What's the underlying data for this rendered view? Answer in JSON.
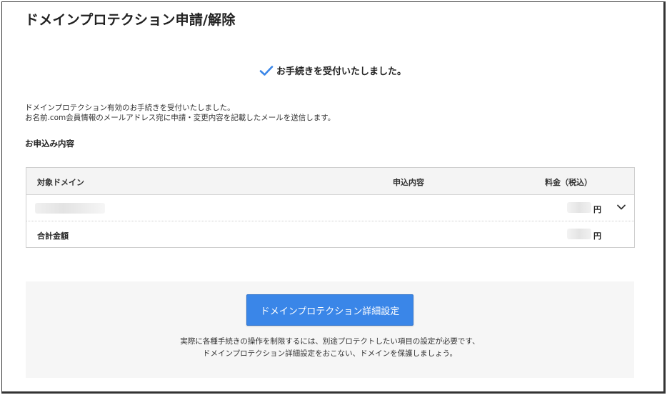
{
  "page": {
    "title": "ドメインプロテクション申請/解除"
  },
  "status": {
    "message": "お手続きを受付いたしました。",
    "icon": "check-icon",
    "icon_color": "#3a86e8"
  },
  "info": {
    "line1": "ドメインプロテクション有効のお手続きを受付いたしました。",
    "line2": "お名前.com会員情報のメールアドレス宛に申請・変更内容を記載したメールを送信します。"
  },
  "order": {
    "section_title": "お申込み内容",
    "columns": {
      "domain": "対象ドメイン",
      "content": "申込内容",
      "price": "料金（税込）"
    },
    "row": {
      "yen": "円",
      "expand_icon": "chevron-down-icon"
    },
    "total": {
      "label": "合計金額",
      "yen": "円"
    }
  },
  "cta": {
    "button_label": "ドメインプロテクション詳細設定",
    "button_color": "#3a86e8",
    "note_line1": "実際に各種手続きの操作を制限するには、別途プロテクトしたい項目の設定が必要です、",
    "note_line2": "ドメインプロテクション詳細設定をおこない、ドメインを保護しましょう。"
  }
}
